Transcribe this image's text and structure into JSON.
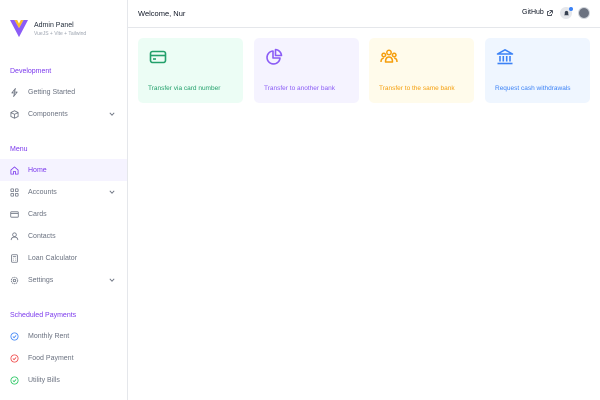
{
  "brand": {
    "title": "Admin Panel",
    "subtitle": "VueJS + Vite + Tailwind"
  },
  "sidebar": {
    "development": {
      "title": "Development",
      "items": [
        {
          "label": "Getting Started",
          "icon": "lightning-icon"
        },
        {
          "label": "Components",
          "icon": "cube-icon"
        }
      ]
    },
    "menu": {
      "title": "Menu",
      "items": [
        {
          "label": "Home",
          "icon": "home-icon"
        },
        {
          "label": "Accounts",
          "icon": "grid-icon"
        },
        {
          "label": "Cards",
          "icon": "credit-card-icon"
        },
        {
          "label": "Contacts",
          "icon": "contacts-icon"
        },
        {
          "label": "Loan Calculator",
          "icon": "calculator-icon"
        },
        {
          "label": "Settings",
          "icon": "gear-icon"
        }
      ]
    },
    "scheduled": {
      "title": "Scheduled Payments",
      "items": [
        {
          "label": "Monthly Rent",
          "icon": "check-circle-icon",
          "color": "#3b82f6"
        },
        {
          "label": "Food Payment",
          "icon": "check-circle-icon",
          "color": "#ef4444"
        },
        {
          "label": "Utility Bills",
          "icon": "check-circle-icon",
          "color": "#22c55e"
        }
      ]
    }
  },
  "topbar": {
    "welcome": "Welcome, Nur",
    "github": "GitHub"
  },
  "cards": [
    {
      "label": "Transfer via card number",
      "icon": "credit-card-icon",
      "color": "#22a06b",
      "bg": "#ecfdf5"
    },
    {
      "label": "Transfer to another bank",
      "icon": "pie-chart-icon",
      "color": "#8b5cf6",
      "bg": "#f5f3ff"
    },
    {
      "label": "Transfer to the same bank",
      "icon": "users-icon",
      "color": "#f59e0b",
      "bg": "#fffbeb"
    },
    {
      "label": "Request cash withdrawals",
      "icon": "bank-icon",
      "color": "#3b82f6",
      "bg": "#eff6ff"
    }
  ],
  "colors": {
    "accent": "#7c3aed",
    "active_bg": "#f5f3ff",
    "muted": "#6b7280",
    "border": "#e5e7eb"
  }
}
